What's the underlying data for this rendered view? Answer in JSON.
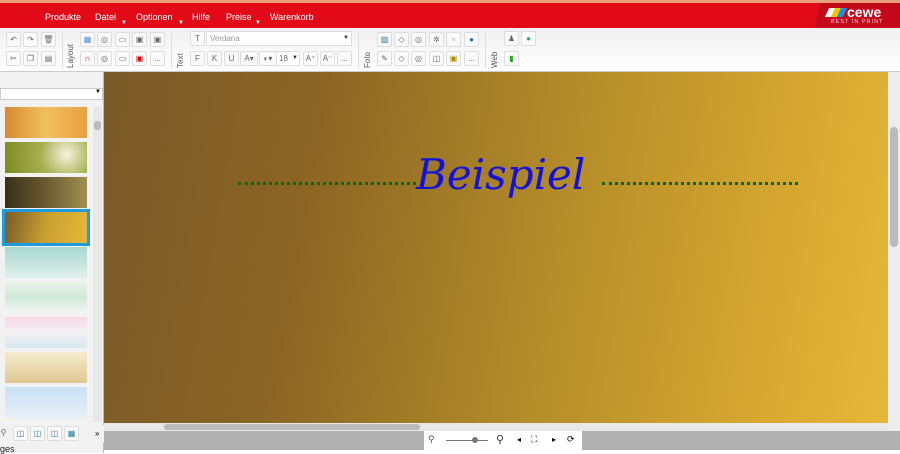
{
  "menu": {
    "items": [
      "Produkte",
      "Datei",
      "Optionen",
      "Hilfe",
      "Preise",
      "Warenkorb"
    ]
  },
  "brand": {
    "name": "cewe",
    "tagline": "BEST IN PRINT"
  },
  "toolbar": {
    "groups": {
      "layout": "Layout",
      "text": "Text",
      "foto": "Foto",
      "web": "Web"
    },
    "font": "Verdana",
    "font_size": "18",
    "bold": "F",
    "italic": "K",
    "underline": "U",
    "more": "..."
  },
  "canvas": {
    "title": "Beispiel",
    "accent": "#1212e0",
    "line_color": "#0a6a0a"
  },
  "left": {
    "bottom_text": "ges"
  }
}
